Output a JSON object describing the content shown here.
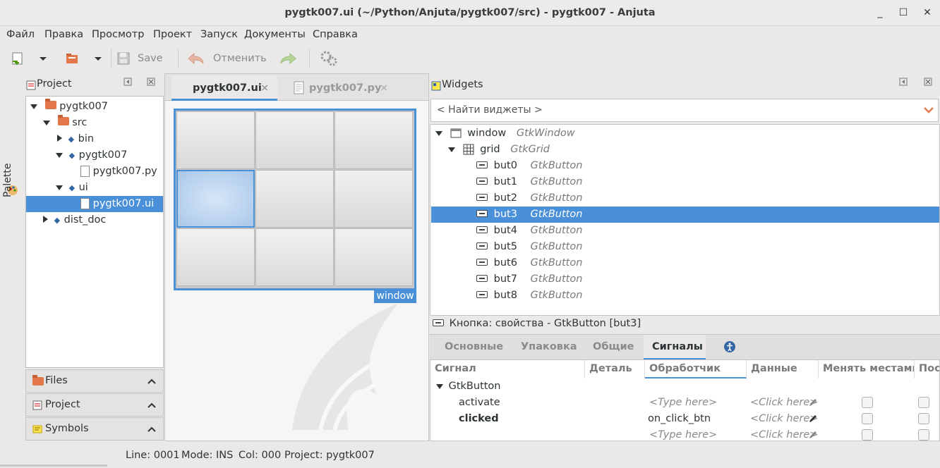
{
  "window": {
    "title": "pygtk007.ui (~/Python/Anjuta/pygtk007/src) - pygtk007 - Anjuta",
    "minimize": "_",
    "maximize": "☐",
    "close": "✕"
  },
  "menu": [
    "Файл",
    "Правка",
    "Просмотр",
    "Проект",
    "Запуск",
    "Документы",
    "Справка"
  ],
  "toolbar": {
    "save": "Save",
    "undo": "Отменить"
  },
  "palette": {
    "label": "Palette"
  },
  "project_panel": {
    "title": "Project",
    "tree": [
      {
        "label": "pygtk007",
        "icon": "folder-icon"
      },
      {
        "label": "src",
        "icon": "folder-icon"
      },
      {
        "label": "bin",
        "icon": "target-icon"
      },
      {
        "label": "pygtk007",
        "icon": "target-icon"
      },
      {
        "label": "pygtk007.py",
        "icon": "file-icon"
      },
      {
        "label": "ui",
        "icon": "target-icon"
      },
      {
        "label": "pygtk007.ui",
        "icon": "file-icon"
      },
      {
        "label": "dist_doc",
        "icon": "target-icon"
      }
    ]
  },
  "dock_buttons": [
    "Files",
    "Project",
    "Symbols"
  ],
  "editor": {
    "dots": "...",
    "tabs": [
      {
        "label": "pygtk007.ui",
        "close": "×"
      },
      {
        "label": "pygtk007.py",
        "close": "×"
      }
    ],
    "window_tag": "window"
  },
  "widgets": {
    "title": "Widgets",
    "search_placeholder": "< Найти виджеты >",
    "rows": [
      {
        "name": "window",
        "type": "GtkWindow"
      },
      {
        "name": "grid",
        "type": "GtkGrid"
      },
      {
        "name": "but0",
        "type": "GtkButton"
      },
      {
        "name": "but1",
        "type": "GtkButton"
      },
      {
        "name": "but2",
        "type": "GtkButton"
      },
      {
        "name": "but3",
        "type": "GtkButton"
      },
      {
        "name": "but4",
        "type": "GtkButton"
      },
      {
        "name": "but5",
        "type": "GtkButton"
      },
      {
        "name": "but6",
        "type": "GtkButton"
      },
      {
        "name": "but7",
        "type": "GtkButton"
      },
      {
        "name": "but8",
        "type": "GtkButton"
      }
    ]
  },
  "properties": {
    "title": "Кнопка: свойства - GtkButton [but3]",
    "tabs": [
      "Основные",
      "Упаковка",
      "Общие",
      "Сигналы"
    ],
    "columns": [
      "Сигнал",
      "Деталь",
      "Обработчик",
      "Данные",
      "Менять местами",
      "Пос"
    ],
    "group": "GtkButton",
    "signals": [
      {
        "name": "activate",
        "handler": "<Type here>",
        "data": "<Click here>"
      },
      {
        "name": "clicked",
        "handler": "on_click_btn",
        "data": "<Click here>"
      },
      {
        "name": "",
        "handler": "<Type here>",
        "data": "<Click here>"
      }
    ]
  },
  "status": {
    "line": "Line: 0001",
    "mode": "Mode: INS",
    "col": "Col: 000",
    "project": "Project: pygtk007"
  }
}
